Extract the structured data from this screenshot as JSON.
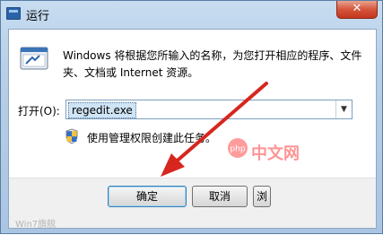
{
  "window": {
    "title": "运行",
    "close_glyph": "✕"
  },
  "dialog": {
    "description": "Windows 将根据您所输入的名称，为您打开相应的程序、文件夹、文档或 Internet 资源。",
    "open_label": "打开(O):",
    "open_value": "regedit.exe",
    "dropdown_glyph": "▼",
    "admin_note": "使用管理权限创建此任务。",
    "buttons": {
      "ok": "确定",
      "cancel": "取消",
      "browse": "浏览(B)..."
    }
  },
  "watermark": {
    "brand": "中文网",
    "logo": "php",
    "bottom_text": "Win7旗舰"
  },
  "colors": {
    "arrow": "#d7261e",
    "close_button": "#c94a30",
    "title_gradient_top": "#c7dcf0"
  },
  "icons": [
    "run-program-icon",
    "uac-shield-icon",
    "close-icon",
    "dropdown-arrow-icon"
  ]
}
